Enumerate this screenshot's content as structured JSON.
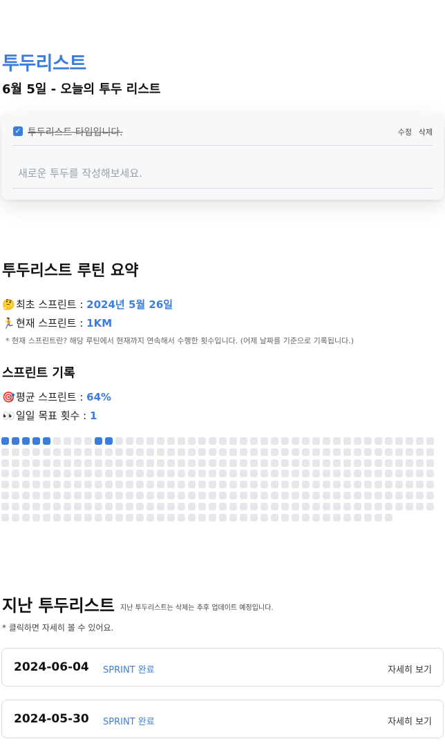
{
  "header": {
    "app_title": "투두리스트",
    "date_title": "6월 5일 - 오늘의 투두 리스트"
  },
  "todo": {
    "item_text": "투두리스트 타입입니다.",
    "item_checked": true,
    "edit_label": "수정",
    "delete_label": "삭제",
    "new_placeholder": "새로운 투두를 작성해보세요."
  },
  "summary": {
    "title": "투두리스트 루틴 요약",
    "first_sprint_emoji": "🤔",
    "first_sprint_label": "최초 스프린트 : ",
    "first_sprint_value": "2024년 5월 26일",
    "current_sprint_emoji": "🏃",
    "current_sprint_label": "현재 스프린트 : ",
    "current_sprint_value": "1KM",
    "note": "* 현재 스프린트란? 해당 루틴에서 현재까지 연속해서 수행한 횟수입니다. (어제 날짜를 기준으로 기록됩니다.)"
  },
  "sprint_record": {
    "title": "스프린트 기록",
    "avg_emoji": "🎯",
    "avg_label": "평균 스프린트 : ",
    "avg_value": "64%",
    "goal_emoji": "👀",
    "goal_label": "일일 목표 횟수 : ",
    "goal_value": "1",
    "grid_filled": [
      0,
      1,
      2,
      3,
      4,
      9,
      10
    ],
    "grid_total": 332,
    "grid_columns": 42
  },
  "past": {
    "title": "지난 투두리스트",
    "subtitle": "지난 투두리스트는 삭제는 추후 업데이트 예정입니다.",
    "hint": "* 클릭하면 자세히 볼 수 있어요.",
    "items": [
      {
        "date": "2024-06-04",
        "status": "SPRINT 완료",
        "more": "자세히 보기"
      },
      {
        "date": "2024-05-30",
        "status": "SPRINT 완료",
        "more": "자세히 보기"
      }
    ]
  },
  "colors": {
    "accent": "#3b7ddd",
    "cell_empty": "#e6e7ea"
  }
}
